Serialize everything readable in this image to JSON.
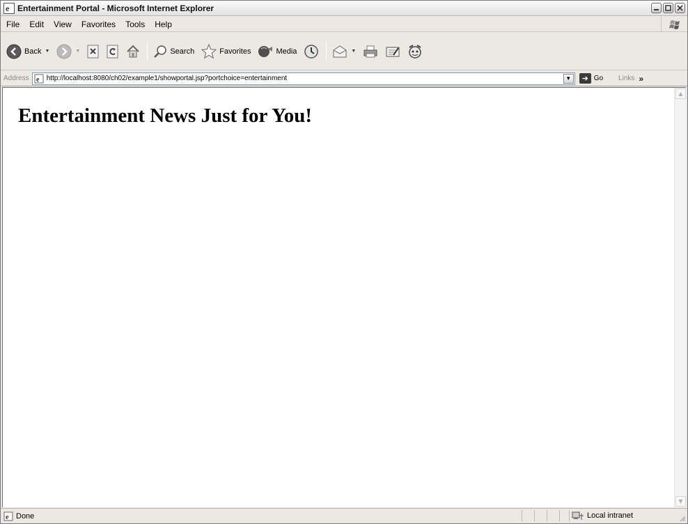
{
  "window": {
    "title": "Entertainment Portal - Microsoft Internet Explorer"
  },
  "menu": {
    "items": [
      "File",
      "Edit",
      "View",
      "Favorites",
      "Tools",
      "Help"
    ]
  },
  "toolbar": {
    "back_label": "Back",
    "search_label": "Search",
    "favorites_label": "Favorites",
    "media_label": "Media"
  },
  "address_bar": {
    "label": "Address",
    "url": "http://localhost:8080/ch02/example1/showportal.jsp?portchoice=entertainment",
    "go_label": "Go",
    "links_label": "Links"
  },
  "page": {
    "heading": "Entertainment News Just for You!"
  },
  "status": {
    "text": "Done",
    "zone": "Local intranet"
  },
  "icons": {
    "back": "back-arrow-icon",
    "forward": "forward-arrow-icon",
    "stop": "stop-icon",
    "refresh": "refresh-icon",
    "home": "home-icon",
    "search": "magnifier-icon",
    "favorites": "star-icon",
    "media": "media-icon",
    "history": "history-icon",
    "mail": "mail-icon",
    "print": "print-icon",
    "edit": "edit-icon",
    "messenger": "messenger-icon"
  }
}
